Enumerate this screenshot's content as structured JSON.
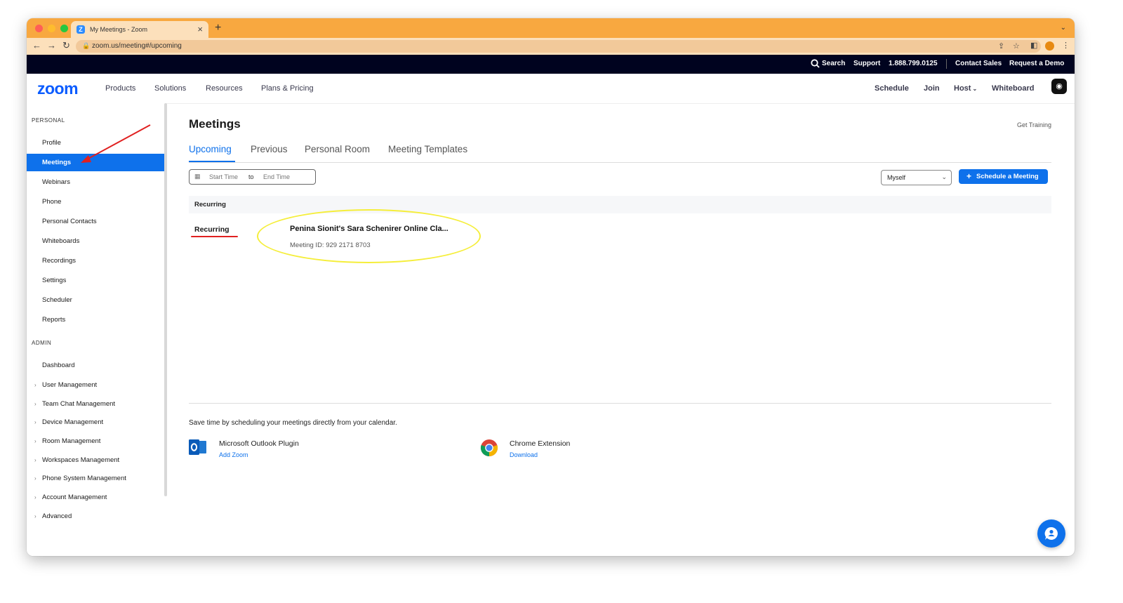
{
  "browser": {
    "tab_title": "My Meetings - Zoom",
    "tab_favicon": "Z",
    "url": "zoom.us/meeting#/upcoming"
  },
  "utility_bar": {
    "search": "Search",
    "support": "Support",
    "phone": "1.888.799.0125",
    "contact_sales": "Contact Sales",
    "request_demo": "Request a Demo"
  },
  "main_nav": {
    "logo": "zoom",
    "items": [
      "Products",
      "Solutions",
      "Resources",
      "Plans & Pricing"
    ],
    "right": {
      "schedule": "Schedule",
      "join": "Join",
      "host": "Host",
      "whiteboard": "Whiteboard"
    }
  },
  "sidebar": {
    "personal_label": "PERSONAL",
    "personal_items": [
      "Profile",
      "Meetings",
      "Webinars",
      "Phone",
      "Personal Contacts",
      "Whiteboards",
      "Recordings",
      "Settings",
      "Scheduler",
      "Reports"
    ],
    "active_item": "Meetings",
    "admin_label": "ADMIN",
    "admin_items": [
      "Dashboard",
      "User Management",
      "Team Chat Management",
      "Device Management",
      "Room Management",
      "Workspaces Management",
      "Phone System Management",
      "Account Management",
      "Advanced"
    ]
  },
  "page": {
    "title": "Meetings",
    "get_training": "Get Training",
    "tabs": [
      "Upcoming",
      "Previous",
      "Personal Room",
      "Meeting Templates"
    ],
    "active_tab": "Upcoming",
    "filters": {
      "start_placeholder": "Start Time",
      "to": "to",
      "end_placeholder": "End Time",
      "owner_select": "Myself",
      "schedule_button": "Schedule a Meeting"
    },
    "group_header": "Recurring",
    "meetings": [
      {
        "when": "Recurring",
        "title": "Penina Sionit's Sara Schenirer Online Cla...",
        "meeting_id": "Meeting ID: 929 2171 8703"
      }
    ],
    "calendar_promo": {
      "text": "Save time by scheduling your meetings directly from your calendar.",
      "outlook": {
        "name": "Microsoft Outlook Plugin",
        "link": "Add Zoom"
      },
      "chrome": {
        "name": "Chrome Extension",
        "link": "Download"
      }
    }
  },
  "colors": {
    "accent": "#0e71eb",
    "tab_strip": "#f8a840",
    "utility_bar": "#00031f",
    "annotation_arrow": "#e02020",
    "annotation_ellipse": "#f5ee3a"
  }
}
